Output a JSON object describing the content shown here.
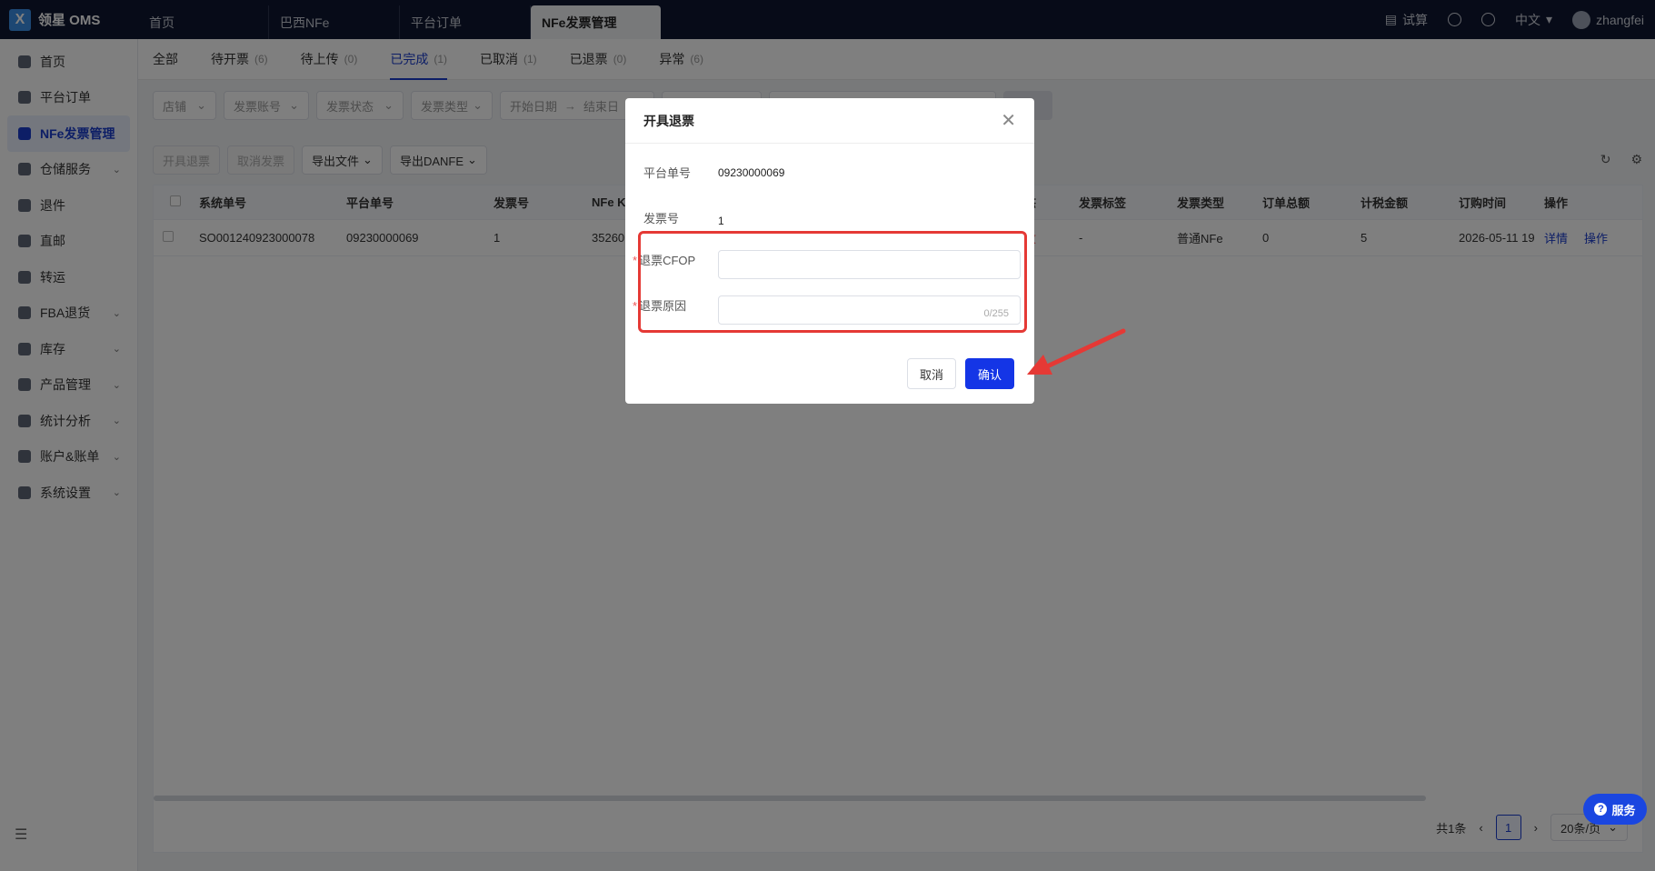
{
  "app": {
    "logo_text": "领星 OMS",
    "logo_mark": "X"
  },
  "top_tabs": [
    {
      "label": "首页"
    },
    {
      "label": "巴西NFe"
    },
    {
      "label": "平台订单"
    },
    {
      "label": "NFe发票管理"
    }
  ],
  "top_right": {
    "trial": "试算",
    "lang": "中文",
    "user": "zhangfei"
  },
  "sidebar": {
    "items": [
      {
        "label": "首页"
      },
      {
        "label": "平台订单"
      },
      {
        "label": "NFe发票管理"
      },
      {
        "label": "仓储服务"
      },
      {
        "label": "退件"
      },
      {
        "label": "直邮"
      },
      {
        "label": "转运"
      },
      {
        "label": "FBA退货"
      },
      {
        "label": "库存"
      },
      {
        "label": "产品管理"
      },
      {
        "label": "统计分析"
      },
      {
        "label": "账户&账单"
      },
      {
        "label": "系统设置"
      }
    ]
  },
  "status_tabs": [
    {
      "label": "全部",
      "count": ""
    },
    {
      "label": "待开票",
      "count": "(6)"
    },
    {
      "label": "待上传",
      "count": "(0)"
    },
    {
      "label": "已完成",
      "count": "(1)"
    },
    {
      "label": "已取消",
      "count": "(1)"
    },
    {
      "label": "已退票",
      "count": "(0)"
    },
    {
      "label": "异常",
      "count": "(6)"
    }
  ],
  "filters": {
    "shop": "店铺",
    "invoice_account": "发票账号",
    "invoice_status": "发票状态",
    "invoice_type": "发票类型",
    "start_date": "开始日期",
    "end_date": "结束日"
  },
  "actions": {
    "issue_refund": "开具退票",
    "cancel_invoice": "取消发票",
    "export_file": "导出文件",
    "export_danfe": "导出DANFE"
  },
  "table": {
    "headers": {
      "system_no": "系统单号",
      "platform_no": "平台单号",
      "invoice_no": "发票号",
      "nfe_key": "NFe K",
      "status": "态",
      "invoice_tag": "发票标签",
      "invoice_type": "发票类型",
      "order_total": "订单总额",
      "tax_amount": "计税金额",
      "order_time": "订购时间",
      "operation": "操作"
    },
    "rows": [
      {
        "system_no": "SO001240923000078",
        "platform_no": "09230000069",
        "invoice_no": "1",
        "nfe_key": "35260",
        "status": "收",
        "invoice_tag": "-",
        "invoice_type": "普通NFe",
        "order_total": "0",
        "tax_amount": "5",
        "order_time": "2026-05-11 19",
        "detail": "详情",
        "operation": "操作"
      }
    ]
  },
  "pager": {
    "total": "共1条",
    "page": "1",
    "size": "20条/页"
  },
  "modal": {
    "title": "开具退票",
    "platform_no_label": "平台单号",
    "platform_no_value": "09230000069",
    "invoice_no_label": "发票号",
    "invoice_no_value": "1",
    "cfop_label": "退票CFOP",
    "reason_label": "退票原因",
    "reason_counter": "0/255",
    "cancel": "取消",
    "confirm": "确认"
  },
  "service": {
    "label": "服务"
  },
  "colors": {
    "accent": "#1a3ccd",
    "topbar": "#0f1730",
    "highlight": "#e53935"
  }
}
